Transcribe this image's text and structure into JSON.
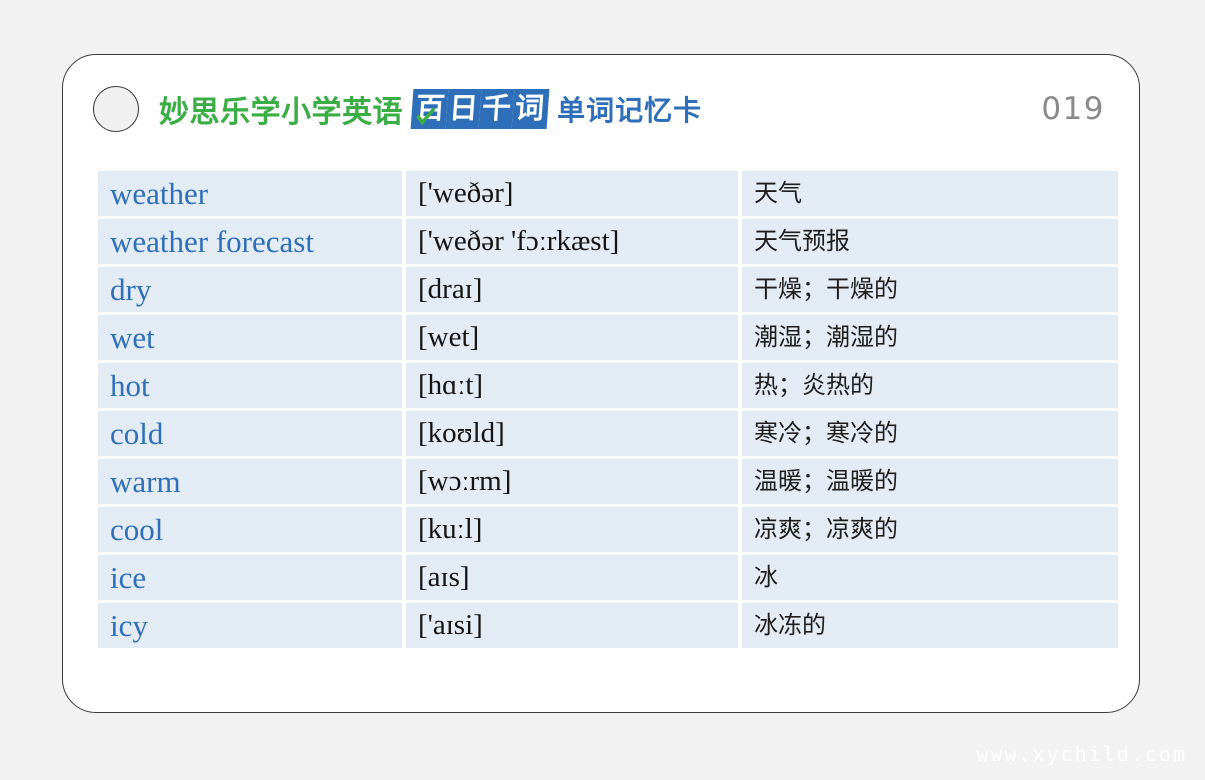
{
  "page": {
    "background_color": "#f2f2f2",
    "watermark": "www.xychild.com"
  },
  "card": {
    "border_color": "#3a3a3a",
    "background_color": "#ffffff",
    "punch_hole_icon": "circle-icon",
    "header": {
      "brand_green": "妙思乐学小学英语",
      "logo_chars": [
        "百",
        "日",
        "千",
        "词"
      ],
      "logo_check_icon": "check-icon",
      "brand_blue": "单词记忆卡",
      "index": "019",
      "green_color": "#3aad45",
      "blue_color": "#2f6fba",
      "index_color": "#8a8a8a"
    },
    "table": {
      "row_background": "#e3ebf4",
      "word_color": "#2f6fba",
      "columns": [
        "word",
        "pronunciation",
        "meaning"
      ],
      "rows": [
        {
          "word": "weather",
          "pron": "['weðər]",
          "mean": "天气"
        },
        {
          "word": "weather forecast",
          "pron": "['weðər 'fɔːrkæst]",
          "mean": "天气预报"
        },
        {
          "word": "dry",
          "pron": "[draɪ]",
          "mean": "干燥；干燥的"
        },
        {
          "word": "wet",
          "pron": "[wet]",
          "mean": "潮湿；潮湿的"
        },
        {
          "word": "hot",
          "pron": "[hɑːt]",
          "mean": "热；炎热的"
        },
        {
          "word": "cold",
          "pron": "[koʊld]",
          "mean": "寒冷；寒冷的"
        },
        {
          "word": "warm",
          "pron": "[wɔːrm]",
          "mean": "温暖；温暖的"
        },
        {
          "word": "cool",
          "pron": "[kuːl]",
          "mean": "凉爽；凉爽的"
        },
        {
          "word": "ice",
          "pron": "[aɪs]",
          "mean": "冰"
        },
        {
          "word": "icy",
          "pron": "['aɪsi]",
          "mean": "冰冻的"
        }
      ]
    }
  }
}
